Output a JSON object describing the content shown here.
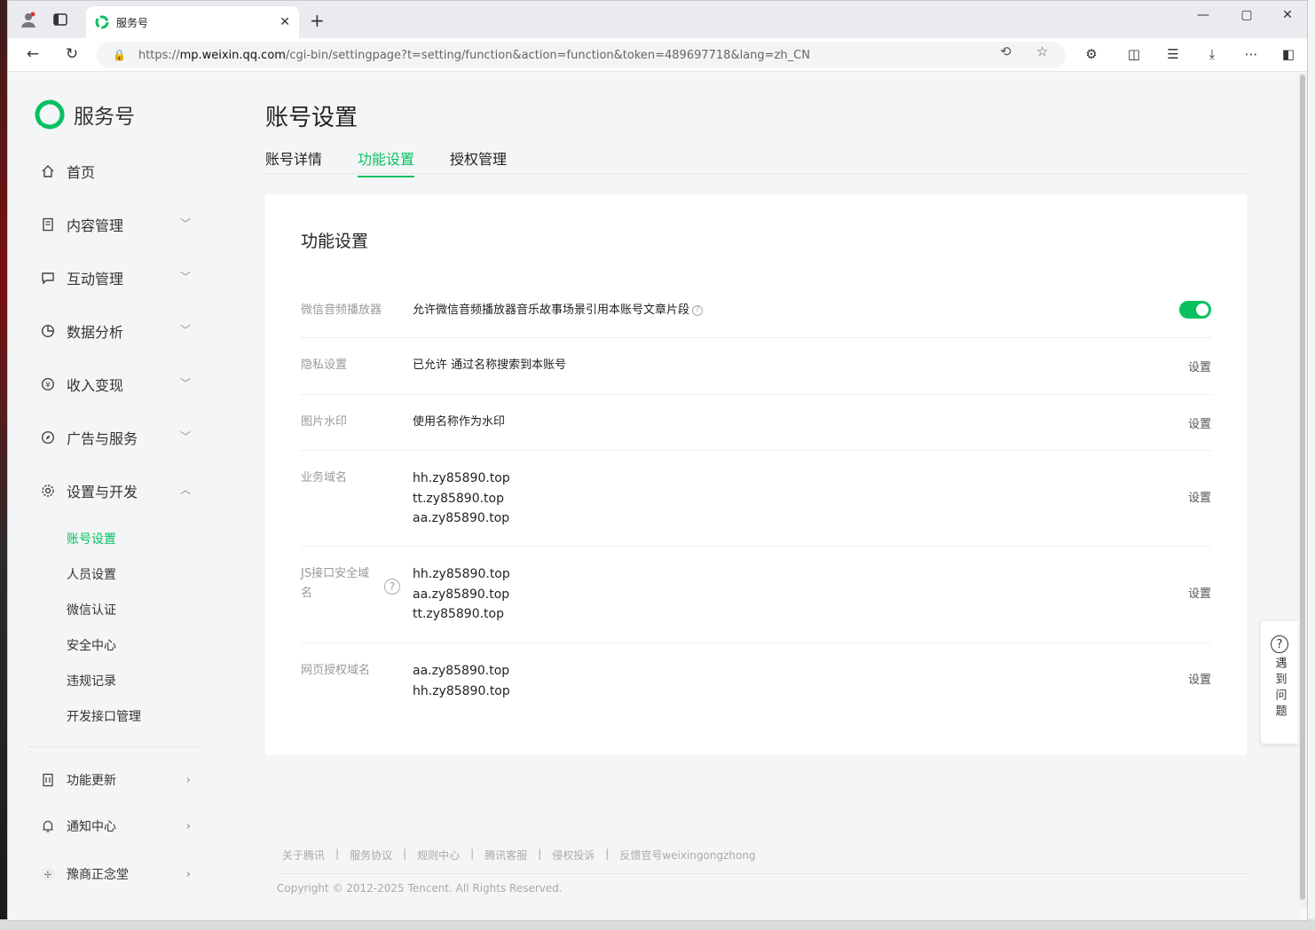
{
  "browser": {
    "tab_title": "服务号",
    "url_prefix": "https://",
    "url_host": "mp.weixin.qq.com",
    "url_path": "/cgi-bin/settingpage?t=setting/function&action=function&token=489697718&lang=zh_CN"
  },
  "sidebar": {
    "brand": "服务号",
    "menu": [
      {
        "label": "首页",
        "icon": "home-icon"
      },
      {
        "label": "内容管理",
        "icon": "document-icon"
      },
      {
        "label": "互动管理",
        "icon": "chat-icon"
      },
      {
        "label": "数据分析",
        "icon": "pie-chart-icon"
      },
      {
        "label": "收入变现",
        "icon": "yuan-icon"
      },
      {
        "label": "广告与服务",
        "icon": "compass-icon"
      },
      {
        "label": "设置与开发",
        "icon": "gear-icon"
      }
    ],
    "submenu": [
      "账号设置",
      "人员设置",
      "微信认证",
      "安全中心",
      "违规记录",
      "开发接口管理"
    ],
    "bottom": [
      {
        "label": "功能更新",
        "icon": "update-icon"
      },
      {
        "label": "通知中心",
        "icon": "bell-icon"
      },
      {
        "label": "豫商正念堂",
        "icon": "avatar-icon"
      }
    ]
  },
  "main": {
    "title": "账号设置",
    "tabs": [
      "账号详情",
      "功能设置",
      "授权管理"
    ],
    "active_tab": "功能设置",
    "card_title": "功能设置",
    "rows": [
      {
        "label": "微信音频播放器",
        "value": "允许微信音频播放器音乐故事场景引用本账号文章片段",
        "toggle_on": true
      },
      {
        "label": "隐私设置",
        "value": "已允许 通过名称搜索到本账号",
        "action": "设置"
      },
      {
        "label": "图片水印",
        "value": "使用名称作为水印",
        "action": "设置"
      },
      {
        "label": "业务域名",
        "values": [
          "hh.zy85890.top",
          "tt.zy85890.top",
          "aa.zy85890.top"
        ],
        "action": "设置"
      },
      {
        "label_line1": "JS接口安全域",
        "label_line2": "名",
        "values": [
          "hh.zy85890.top",
          "aa.zy85890.top",
          "tt.zy85890.top"
        ],
        "action": "设置"
      },
      {
        "label": "网页授权域名",
        "values": [
          "aa.zy85890.top",
          "hh.zy85890.top"
        ],
        "action": "设置"
      }
    ]
  },
  "footer": {
    "links": [
      "关于腾讯",
      "服务协议",
      "规则中心",
      "腾讯客服",
      "侵权投诉",
      "反馈官号weixingongzhong"
    ],
    "separator": "|",
    "copyright": "Copyright © 2012-2025 Tencent. All Rights Reserved."
  },
  "help_widget": {
    "label": "遇到问题"
  },
  "colors": {
    "accent": "#07c160"
  }
}
